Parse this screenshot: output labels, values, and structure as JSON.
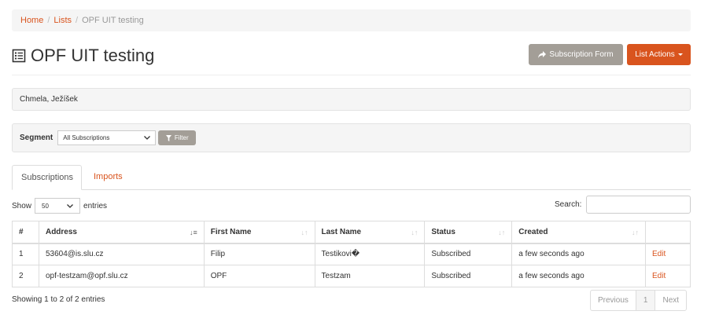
{
  "breadcrumb": {
    "home": "Home",
    "lists": "Lists",
    "current": "OPF UIT testing"
  },
  "page": {
    "title": "OPF UIT testing"
  },
  "buttons": {
    "subscription_form": "Subscription Form",
    "list_actions": "List Actions"
  },
  "owners": "Chmela, Ježíšek",
  "segment": {
    "label": "Segment",
    "selected": "All Subscriptions",
    "filter": "Filter"
  },
  "tabs": {
    "subscriptions": "Subscriptions",
    "imports": "Imports"
  },
  "length": {
    "show": "Show",
    "value": "50",
    "entries": "entries"
  },
  "search": {
    "label": "Search:",
    "value": ""
  },
  "table": {
    "headers": [
      "#",
      "Address",
      "First Name",
      "Last Name",
      "Status",
      "Created"
    ],
    "rows": [
      {
        "num": "1",
        "address": "53604@is.slu.cz",
        "first": "Filip",
        "last": "Testikovi�",
        "status": "Subscribed",
        "created": "a few seconds ago",
        "action": "Edit"
      },
      {
        "num": "2",
        "address": "opf-testzam@opf.slu.cz",
        "first": "OPF",
        "last": "Testzam",
        "status": "Subscribed",
        "created": "a few seconds ago",
        "action": "Edit"
      }
    ]
  },
  "info": "Showing 1 to 2 of 2 entries",
  "pagination": {
    "previous": "Previous",
    "page": "1",
    "next": "Next"
  },
  "colors": {
    "accent": "#d9541e",
    "muted_button": "#a39e97"
  }
}
